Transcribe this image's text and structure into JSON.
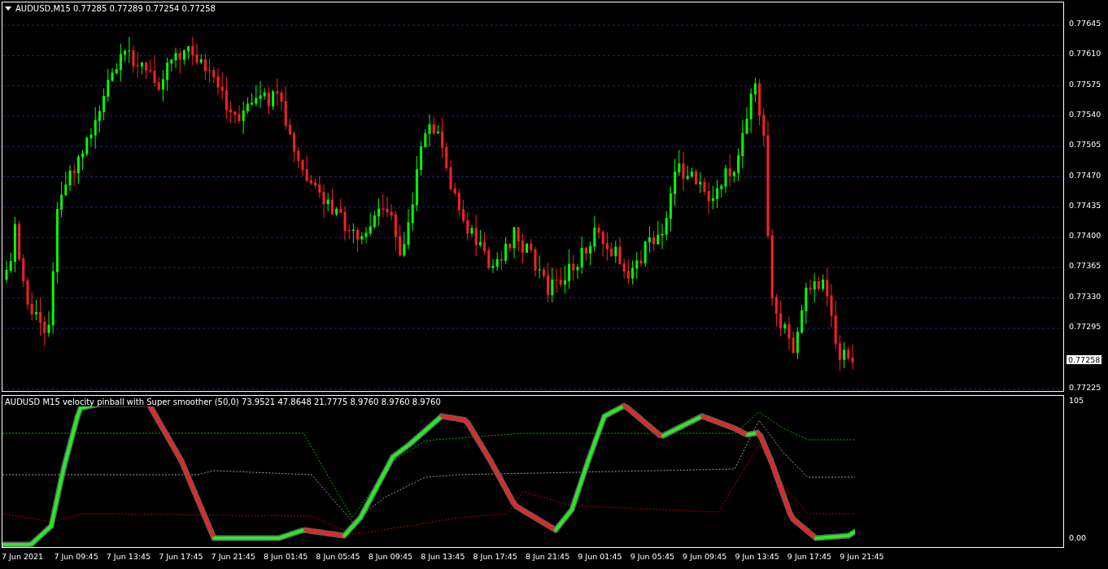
{
  "price_chart": {
    "title": "AUDUSD,M15  0.77285 0.77289 0.77254 0.77258",
    "price_ticks": [
      "0.77645",
      "0.77610",
      "0.77575",
      "0.77540",
      "0.77505",
      "0.77470",
      "0.77435",
      "0.77400",
      "0.77365",
      "0.77330",
      "0.77295",
      "0.77225"
    ],
    "current_price": "0.77258"
  },
  "indicator": {
    "title": "AUDUSD M15 velocity pinball with Super smoother (50,0) 73.9521 47.8648 21.7775 8.9760 8.9760 8.9760",
    "ticks": [
      "105",
      "0.00"
    ]
  },
  "time_axis": [
    "7 Jun 2021",
    "7 Jun 09:45",
    "7 Jun 13:45",
    "7 Jun 17:45",
    "7 Jun 21:45",
    "8 Jun 01:45",
    "8 Jun 05:45",
    "8 Jun 09:45",
    "8 Jun 13:45",
    "8 Jun 17:45",
    "8 Jun 21:45",
    "9 Jun 01:45",
    "9 Jun 05:45",
    "9 Jun 09:45",
    "9 Jun 13:45",
    "9 Jun 17:45",
    "9 Jun 21:45"
  ]
}
